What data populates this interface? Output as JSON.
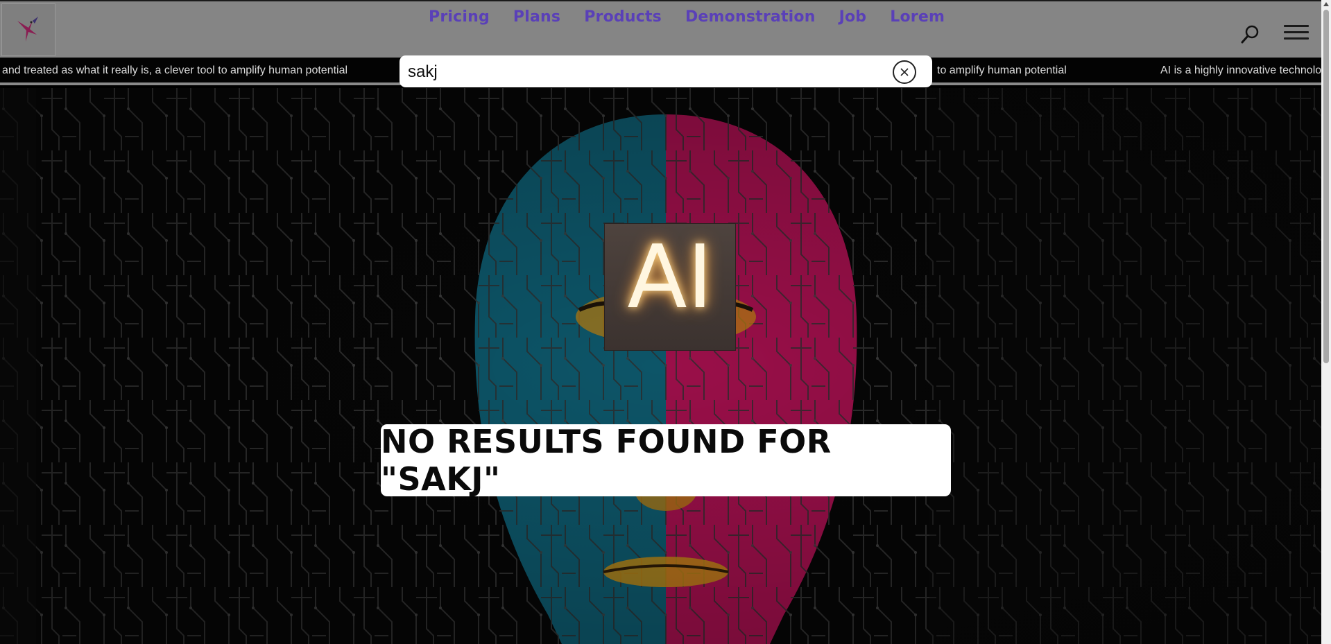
{
  "header": {
    "logo_name": "hummingbird-logo",
    "nav": [
      "Pricing",
      "Plans",
      "Products",
      "Demonstration",
      "Job",
      "Lorem"
    ],
    "search_icon": "search-icon",
    "menu_icon": "hamburger-menu-icon"
  },
  "ticker": {
    "items": [
      "and treated as what it really is, a clever tool to amplify human potential",
      "to amplify human potential",
      "AI is a highly innovative technolo"
    ]
  },
  "search": {
    "value": "sakj",
    "clear_icon": "close-circle-icon"
  },
  "hero": {
    "chip_text": "AI",
    "no_results": "NO RESULTS FOUND FOR \"SAKJ\""
  },
  "colors": {
    "header_bg": "#858585",
    "nav_text": "#5a40b8",
    "ticker_bg": "#030303",
    "face_left": "#0e5f73",
    "face_right": "#a8104e",
    "face_gold": "#c8890f"
  }
}
